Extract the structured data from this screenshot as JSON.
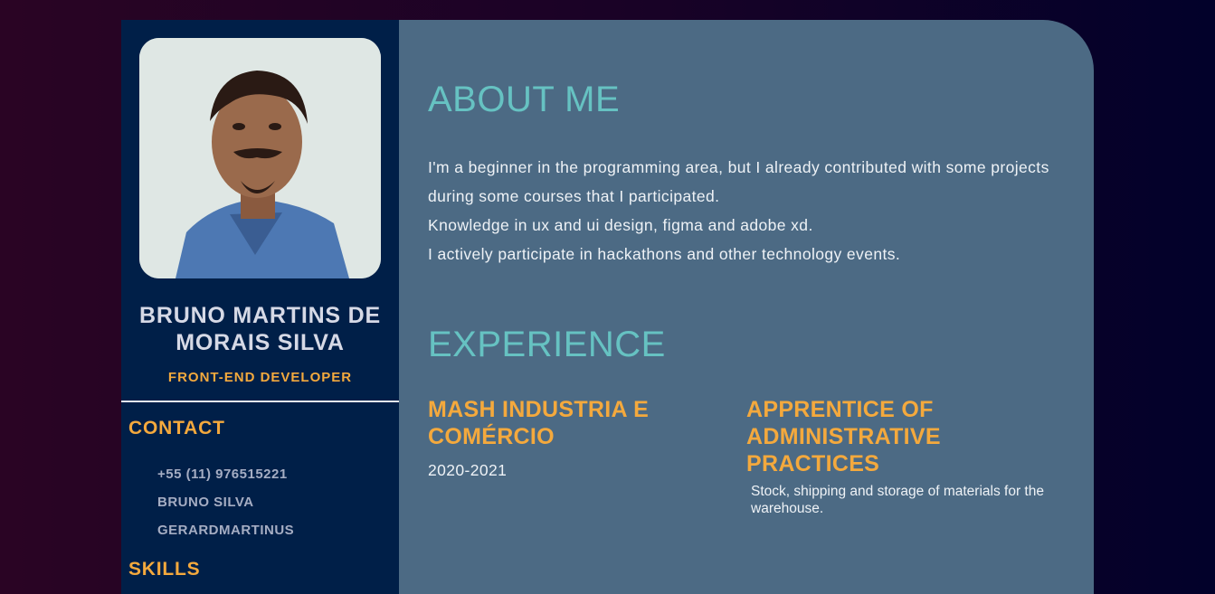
{
  "profile": {
    "name": "BRUNO MARTINS DE MORAIS SILVA",
    "role": "FRONT-END DEVELOPER"
  },
  "contact": {
    "title": "CONTACT",
    "items": [
      "+55 (11) 976515221",
      "BRUNO SILVA",
      "GERARDMARTINUS"
    ]
  },
  "skills": {
    "title": "SKILLS"
  },
  "about": {
    "title": "ABOUT ME",
    "lines": [
      "I'm a beginner in the programming area, but I already contributed with some projects during some courses that I participated.",
      "Knowledge in ux and ui design, figma and adobe xd.",
      "I actively participate in hackathons and other technology events."
    ]
  },
  "experience": {
    "title": "EXPERIENCE",
    "jobs": [
      {
        "title": "MASH INDUSTRIA E COMÉRCIO",
        "dates": "2020-2021"
      },
      {
        "title": "APPRENTICE OF ADMINISTRATIVE PRACTICES",
        "description": "Stock, shipping and storage of materials for the warehouse."
      }
    ]
  },
  "colors": {
    "accent": "#f4a93d",
    "heading": "#66c2c2",
    "sidebar": "#001f48",
    "main": "#4c6a84"
  }
}
